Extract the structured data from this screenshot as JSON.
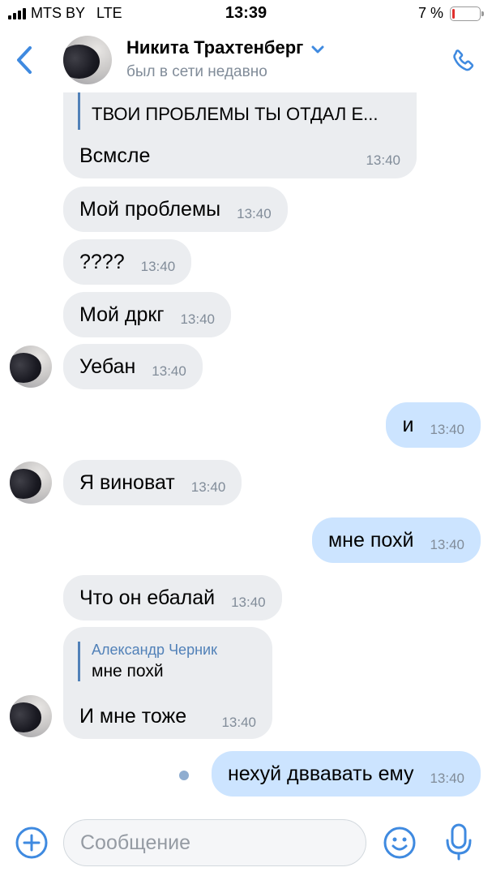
{
  "status_bar": {
    "carrier": "MTS BY",
    "network": "LTE",
    "time": "13:39",
    "battery_percent": "7 %",
    "battery_level": 0.07,
    "battery_color": "#e0302e"
  },
  "header": {
    "contact_name": "Никита Трахтенберг",
    "status": "был в сети недавно",
    "accent_color": "#3f8ae0"
  },
  "messages": [
    {
      "dir": "in",
      "reply_text": "ТВОИ ПРОБЛЕМЫ ТЫ ОТДАЛ Е...",
      "text": "Всмсле",
      "time": "13:40"
    },
    {
      "dir": "in",
      "text": "Мой проблемы",
      "time": "13:40"
    },
    {
      "dir": "in",
      "text": "????",
      "time": "13:40"
    },
    {
      "dir": "in",
      "text": "Мой дркг",
      "time": "13:40"
    },
    {
      "dir": "in",
      "text": "Уебан",
      "time": "13:40"
    },
    {
      "dir": "out",
      "text": "и",
      "time": "13:40"
    },
    {
      "dir": "in",
      "text": "Я виноват",
      "time": "13:40"
    },
    {
      "dir": "out",
      "text": "мне похй",
      "time": "13:40"
    },
    {
      "dir": "in",
      "text": "Что он ебалай",
      "time": "13:40"
    },
    {
      "dir": "in",
      "reply_author": "Александр Черник",
      "reply_text": "мне похй",
      "text": "И мне тоже",
      "time": "13:40"
    },
    {
      "dir": "out",
      "text": "нехуй дввавать ему",
      "time": "13:40",
      "unread": true
    }
  ],
  "composer": {
    "placeholder": "Сообщение"
  },
  "icons": [
    "back-chevron-icon",
    "chevron-down-icon",
    "phone-icon",
    "plus-circle-icon",
    "smile-icon",
    "microphone-icon"
  ]
}
